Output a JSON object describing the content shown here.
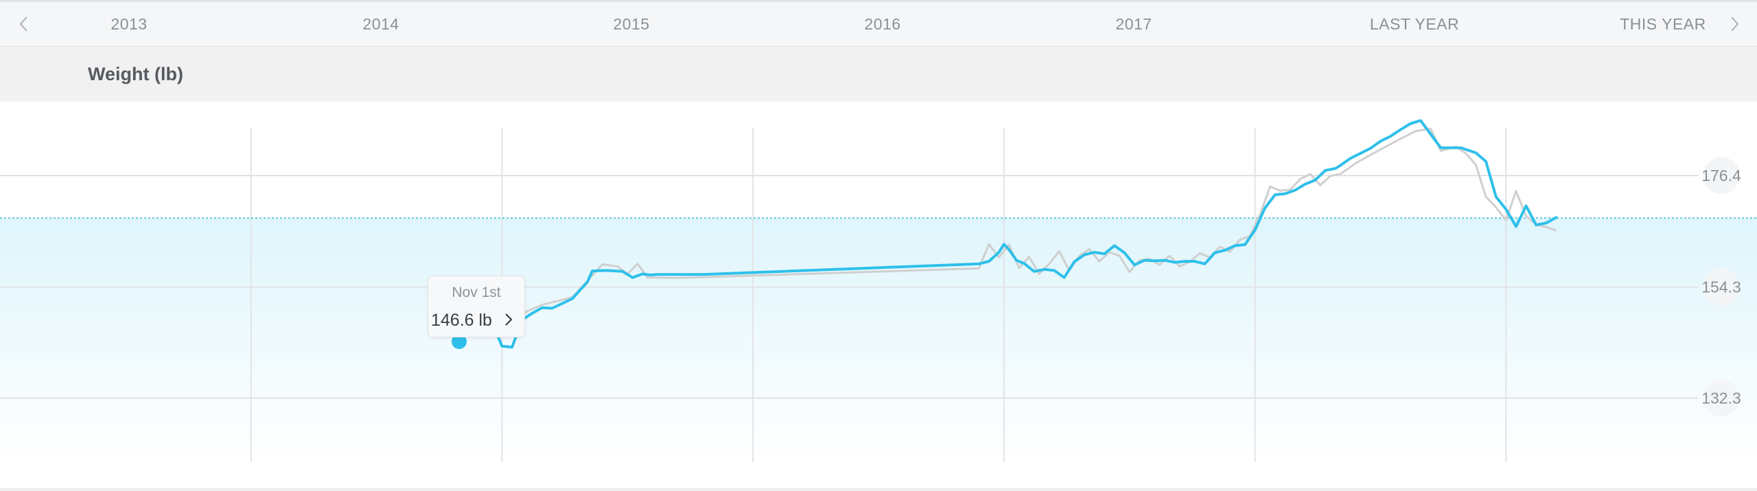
{
  "year_nav": {
    "tabs": [
      "2013",
      "2014",
      "2015",
      "2016",
      "2017",
      "LAST YEAR",
      "THIS YEAR"
    ],
    "prev_icon": "chevron-left-icon",
    "next_icon": "chevron-right-icon"
  },
  "section": {
    "title": "Weight (lb)"
  },
  "tooltip": {
    "date": "Nov 1st",
    "value": "146.6 lb",
    "icon": "chevron-right-icon"
  },
  "colors": {
    "trend_line": "#2ec0ea",
    "raw_line": "#cfcfcf",
    "band_fill": "#dff5fc",
    "target_line": "#3ab8dc",
    "grid": "#e2e3e5",
    "tick_text": "#8c8f94"
  },
  "chart_data": {
    "type": "line",
    "y_tick_labels": [
      "176.4",
      "154.3",
      "132.3"
    ],
    "y_ticks": [
      176.4,
      154.3,
      132.3
    ],
    "ylim": [
      119.6,
      187.0
    ],
    "xlim": [
      2013.0,
      2020.0
    ],
    "grid": true,
    "target_value": 168.0,
    "highlight": {
      "x": 2014.83,
      "y": 146.6,
      "label_date": "Nov 1st",
      "label_value": "146.6 lb"
    },
    "series": [
      {
        "x": [
          2014.96,
          2014.98,
          2015.0,
          2015.04,
          2015.08,
          2015.12,
          2015.16,
          2015.2,
          2015.28,
          2015.34,
          2015.36,
          2015.42,
          2015.48,
          2015.52,
          2015.56,
          2015.59,
          2015.62,
          2015.66,
          2015.7,
          2015.8,
          2016.9,
          2016.94,
          2016.98,
          2017.0,
          2017.02,
          2017.05,
          2017.08,
          2017.12,
          2017.16,
          2017.2,
          2017.24,
          2017.28,
          2017.32,
          2017.36,
          2017.4,
          2017.44,
          2017.48,
          2017.52,
          2017.56,
          2017.6,
          2017.64,
          2017.68,
          2017.72,
          2017.76,
          2017.8,
          2017.84,
          2017.88,
          2017.92,
          2017.96,
          2018.0,
          2018.04,
          2018.08,
          2018.12,
          2018.16,
          2018.2,
          2018.24,
          2018.28,
          2018.32,
          2018.34,
          2018.38,
          2018.46,
          2018.5,
          2018.54,
          2018.58,
          2018.62,
          2018.66,
          2018.74,
          2018.82,
          2018.88,
          2018.92,
          2018.96,
          2019.0,
          2019.04,
          2019.08,
          2019.12,
          2019.16,
          2019.2
        ],
        "y": [
          145.8,
          145.0,
          142.6,
          142.4,
          147.8,
          149.1,
          150.2,
          150.1,
          152.0,
          155.3,
          157.5,
          157.6,
          157.4,
          156.2,
          156.9,
          156.7,
          156.8,
          156.8,
          156.8,
          156.8,
          158.9,
          159.4,
          161.2,
          162.8,
          161.7,
          159.6,
          159.0,
          157.4,
          157.8,
          157.6,
          156.2,
          159.3,
          160.7,
          161.2,
          160.9,
          162.5,
          161.1,
          158.7,
          159.6,
          159.5,
          159.6,
          159.2,
          159.4,
          159.4,
          158.9,
          161.1,
          161.6,
          162.5,
          162.7,
          165.6,
          170.0,
          172.6,
          172.8,
          173.5,
          174.7,
          175.5,
          177.4,
          177.8,
          178.4,
          179.8,
          181.8,
          183.2,
          184.2,
          185.5,
          186.7,
          187.3,
          181.9,
          181.9,
          180.9,
          179.2,
          172.2,
          169.7,
          166.3,
          170.4,
          166.6,
          167.0,
          168.1
        ]
      },
      {
        "x": [
          2015.0,
          2015.04,
          2015.1,
          2015.16,
          2015.22,
          2015.28,
          2015.34,
          2015.4,
          2015.46,
          2015.5,
          2015.54,
          2015.58,
          2015.7,
          2016.9,
          2016.94,
          2016.98,
          2017.02,
          2017.06,
          2017.1,
          2017.14,
          2017.18,
          2017.22,
          2017.26,
          2017.3,
          2017.34,
          2017.38,
          2017.42,
          2017.46,
          2017.5,
          2017.54,
          2017.58,
          2017.62,
          2017.66,
          2017.7,
          2017.74,
          2017.78,
          2017.82,
          2017.86,
          2017.9,
          2017.94,
          2017.98,
          2018.02,
          2018.06,
          2018.1,
          2018.14,
          2018.18,
          2018.22,
          2018.26,
          2018.3,
          2018.34,
          2018.4,
          2018.46,
          2018.52,
          2018.58,
          2018.64,
          2018.7,
          2018.74,
          2018.8,
          2018.84,
          2018.88,
          2018.92,
          2018.96,
          2019.0,
          2019.04,
          2019.08,
          2019.12,
          2019.16,
          2019.2
        ],
        "y": [
          146.3,
          147.4,
          149.5,
          150.8,
          151.5,
          152.3,
          155.5,
          158.8,
          158.4,
          156.9,
          158.9,
          156.2,
          156.1,
          158.0,
          162.8,
          160.2,
          162.7,
          158.1,
          160.3,
          156.9,
          158.9,
          161.4,
          157.6,
          160.5,
          161.8,
          159.4,
          161.2,
          160.5,
          157.3,
          159.6,
          159.9,
          158.7,
          160.5,
          158.4,
          159.3,
          161.0,
          160.2,
          162.3,
          161.3,
          163.7,
          164.4,
          168.7,
          174.2,
          173.4,
          173.6,
          175.7,
          176.7,
          174.5,
          176.3,
          176.7,
          178.8,
          180.5,
          182.1,
          183.7,
          185.2,
          185.7,
          181.3,
          182.1,
          180.8,
          178.5,
          172.2,
          170.1,
          167.6,
          173.3,
          168.4,
          166.7,
          166.2,
          165.5
        ]
      }
    ]
  }
}
